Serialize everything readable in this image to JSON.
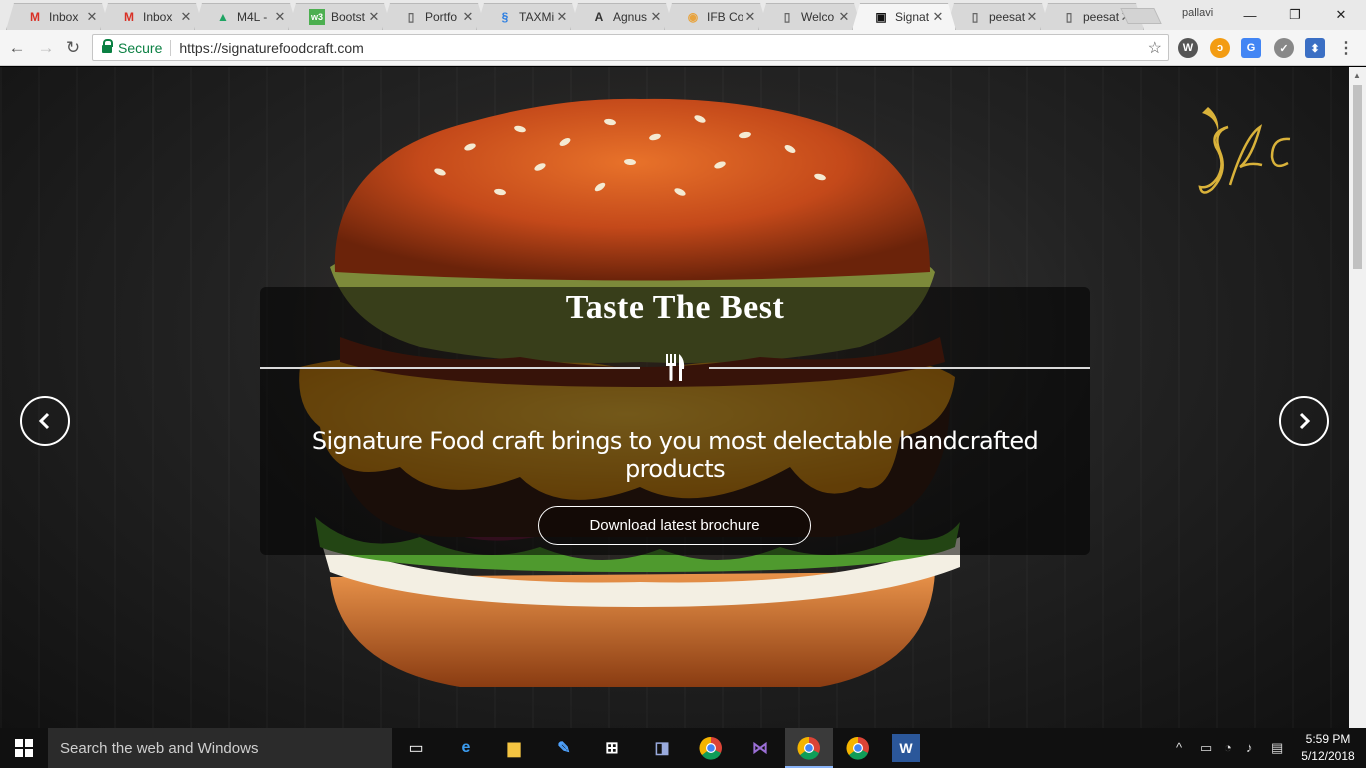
{
  "browser": {
    "tabs": [
      {
        "title": "Inbox",
        "icon": "gmail-icon",
        "color": "#d93025"
      },
      {
        "title": "Inbox",
        "icon": "gmail-icon",
        "color": "#d93025"
      },
      {
        "title": "M4L -",
        "icon": "google-drive-icon",
        "color": "#1fa463"
      },
      {
        "title": "Bootst",
        "icon": "w3schools-icon",
        "color": "#4caf50"
      },
      {
        "title": "Portfo",
        "icon": "document-icon",
        "color": "#666666"
      },
      {
        "title": "TAXMi",
        "icon": "taxmi-icon",
        "color": "#2a7de1"
      },
      {
        "title": "Agnus",
        "icon": "font-a-icon",
        "color": "#333333"
      },
      {
        "title": "IFB Co",
        "icon": "ifb-icon",
        "color": "#e8a33d"
      },
      {
        "title": "Welco",
        "icon": "document-icon",
        "color": "#666666"
      },
      {
        "title": "Signat",
        "icon": "sfc-favicon-icon",
        "color": "#111111",
        "active": true
      },
      {
        "title": "peesat",
        "icon": "document-icon",
        "color": "#666666"
      },
      {
        "title": "peesat",
        "icon": "document-icon",
        "color": "#666666"
      }
    ],
    "profile_name": "pallavi",
    "address": {
      "secure_label": "Secure",
      "url": "https://signaturefoodcraft.com"
    }
  },
  "hero": {
    "title": "Taste The Best",
    "subtitle": "Signature Food craft brings to you most delectable handcrafted products",
    "cta_label": "Download latest brochure",
    "accent_color": "#d9b23a"
  },
  "taskbar": {
    "search_placeholder": "Search the web and Windows",
    "time": "5:59 PM",
    "date": "5/12/2018"
  }
}
